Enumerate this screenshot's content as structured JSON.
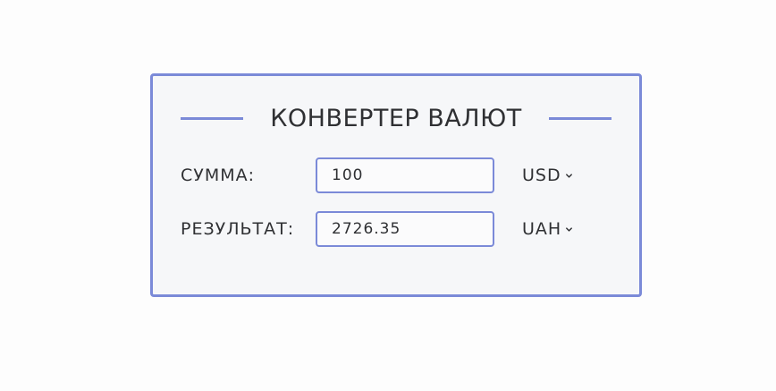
{
  "converter": {
    "title": "КОНВЕРТЕР ВАЛЮТ",
    "amount": {
      "label": "СУММА:",
      "value": "100",
      "currency": "USD"
    },
    "result": {
      "label": "РЕЗУЛЬТАТ:",
      "value": "2726.35",
      "currency": "UAH"
    }
  },
  "colors": {
    "accent": "#7b8ad8",
    "card_background": "#f6f7f9",
    "text": "#2f3033"
  },
  "icons": {
    "dropdown": "chevron-down-icon"
  }
}
